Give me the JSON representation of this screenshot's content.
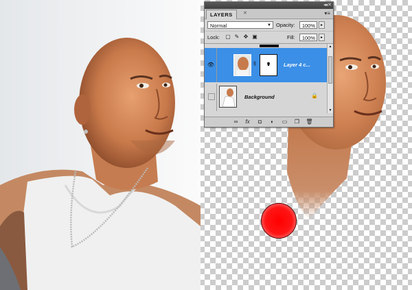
{
  "panel": {
    "tab": "LAYERS",
    "blend_mode": "Normal",
    "opacity_label": "Opacity:",
    "opacity_value": "100%",
    "lock_label": "Lock:",
    "fill_label": "Fill:",
    "fill_value": "100%",
    "layers": [
      {
        "name": "Layer 4 c...",
        "selected": true,
        "visible": true
      },
      {
        "name": "Background",
        "selected": false,
        "visible": false,
        "locked": true
      }
    ]
  },
  "colors": {
    "selection": "#3b8fe6",
    "brush": "#ff0000"
  }
}
